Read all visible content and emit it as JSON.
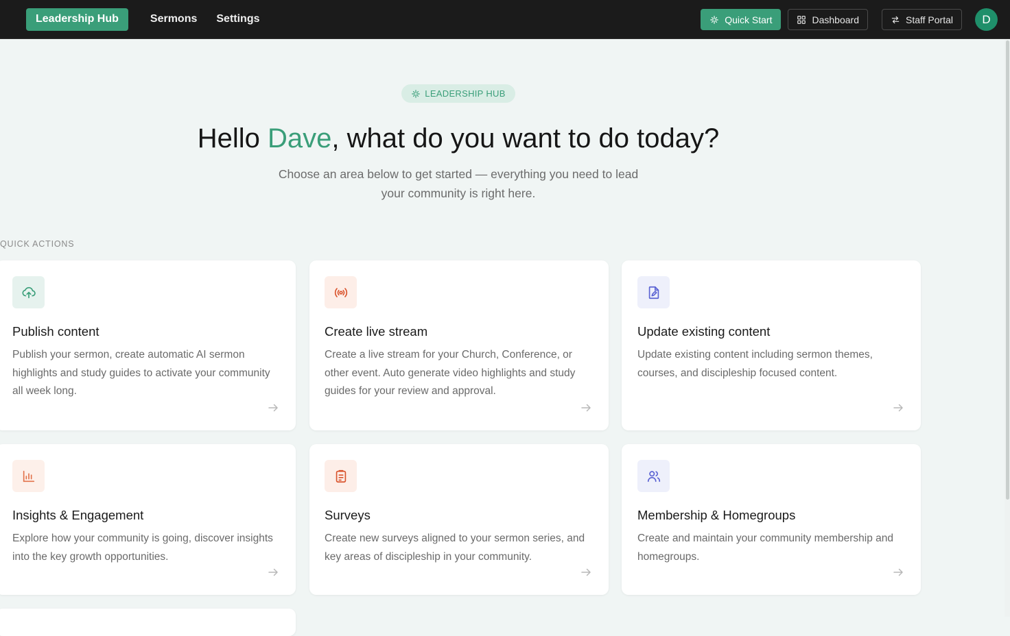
{
  "nav": {
    "brand": "Leadership Hub",
    "links": [
      "Sermons",
      "Settings"
    ],
    "quick_start": "Quick Start",
    "dashboard": "Dashboard",
    "staff_portal": "Staff Portal",
    "avatar_initial": "D"
  },
  "hero": {
    "pill": "LEADERSHIP HUB",
    "greeting_pre": "Hello ",
    "name": "Dave",
    "greeting_post": ", what do you want to do today?",
    "subline": "Choose an area below to get started — everything you need to lead your community is right here."
  },
  "section_label": "QUICK ACTIONS",
  "cards": [
    {
      "title": "Publish content",
      "desc": "Publish your sermon, create automatic AI sermon highlights and study guides to activate your community all week long.",
      "icon": "cloud-upload-icon"
    },
    {
      "title": "Create live stream",
      "desc": "Create a live stream for your Church, Conference, or other event. Auto generate video highlights and study guides for your review and approval.",
      "icon": "broadcast-icon"
    },
    {
      "title": "Update existing content",
      "desc": "Update existing content including sermon themes, courses, and discipleship focused content.",
      "icon": "file-edit-icon"
    },
    {
      "title": "Insights & Engagement",
      "desc": "Explore how your community is going, discover insights into the key growth opportunities.",
      "icon": "bar-chart-icon"
    },
    {
      "title": "Surveys",
      "desc": "Create new surveys aligned to your sermon series, and key areas of discipleship in your community.",
      "icon": "clipboard-icon"
    },
    {
      "title": "Membership & Homegroups",
      "desc": "Create and maintain your community membership and homegroups.",
      "icon": "users-icon"
    }
  ],
  "colors": {
    "accent": "#3a9e79",
    "topbar": "#1b1b1b",
    "background": "#f0f5f4"
  }
}
